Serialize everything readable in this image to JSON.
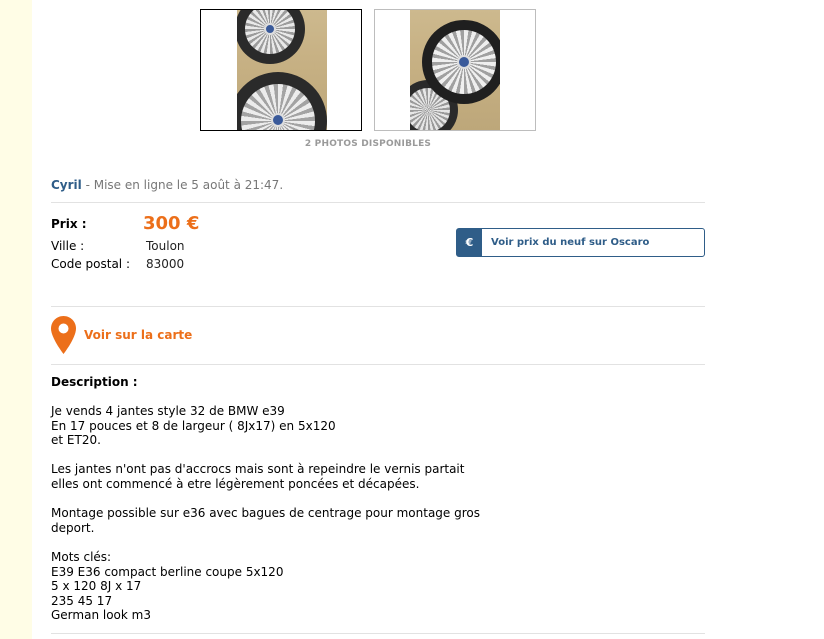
{
  "gallery": {
    "photos_count_label": "2 PHOTOS DISPONIBLES"
  },
  "listing": {
    "seller": "Cyril",
    "posted": " - Mise en ligne le 5 août à 21:47."
  },
  "details": {
    "price_label": "Prix :",
    "price_value": "300 €",
    "city_label": "Ville :",
    "city_value": "Toulon",
    "zip_label": "Code postal :",
    "zip_value": "83000"
  },
  "oscaro": {
    "icon_glyph": "€",
    "label": "Voir prix du neuf sur Oscaro"
  },
  "map": {
    "label": "Voir sur la carte"
  },
  "description": {
    "title": "Description :",
    "paragraphs": [
      "Je vends 4 jantes style 32 de BMW e39\nEn 17 pouces et 8 de largeur ( 8Jx17) en 5x120\net ET20.",
      "Les jantes n'ont pas d'accrocs mais sont à repeindre le vernis partait\nelles ont commencé à etre légèrement poncées et décapées.",
      "Montage possible sur e36 avec bagues de centrage pour montage gros\ndeport.",
      "Mots clés:\nE39 E36 compact berline coupe 5x120\n5 x 120 8J x 17\n235 45 17\nGerman look m3"
    ]
  },
  "colors": {
    "accent_orange": "#ec6f1a",
    "accent_blue": "#2f5d88",
    "left_band": "#fffde6"
  }
}
